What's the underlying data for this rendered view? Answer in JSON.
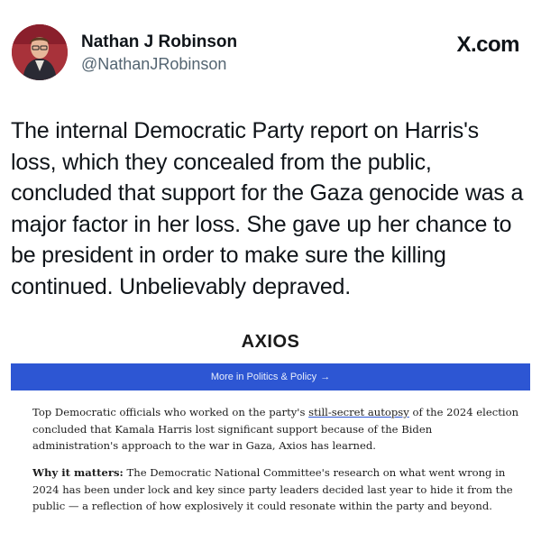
{
  "tweet": {
    "author_name": "Nathan J Robinson",
    "author_handle": "@NathanJRobinson",
    "source_brand": "X.com",
    "text": "The internal Democratic Party report on Harris's loss, which they concealed from the public, concluded that support for the Gaza genocide was a major factor in her loss. She gave up her chance to be president in order to make sure the killing continued. Unbelievably depraved."
  },
  "article": {
    "publisher": "AXIOS",
    "more_link": "More in Politics & Policy",
    "more_arrow": "→",
    "paragraph1": {
      "before": "Top Democratic officials who worked on the party's ",
      "link": "still-secret autopsy",
      "after": " of the 2024 election concluded that Kamala Harris lost significant support because of the Biden administration's approach to the war in Gaza, Axios has learned."
    },
    "paragraph2": {
      "lead": "Why it matters:",
      "text": " The Democratic National Committee's research on what went wrong in 2024 has been under lock and key since party leaders decided last year to hide it from the public — a reflection of how explosively it could resonate within the party and beyond."
    }
  },
  "colors": {
    "axios_bar": "#2d56d3",
    "handle": "#536471",
    "text": "#0f1419"
  }
}
